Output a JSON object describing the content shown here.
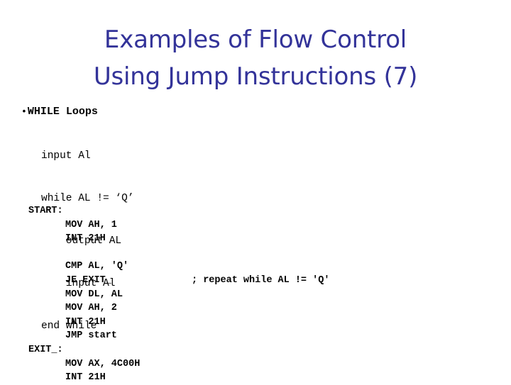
{
  "slide": {
    "background_color": "#ffffff",
    "title_color": "#333399",
    "text_color": "#000000",
    "title": {
      "lines": [
        "Examples of Flow Control",
        "Using Jump Instructions (7)"
      ]
    },
    "bullet": {
      "marker": "bullet-icon",
      "marker_glyph": "•",
      "label": "WHILE Loops"
    },
    "pseudocode": {
      "lines": [
        "input Al",
        "while AL != ‘Q’",
        "    output AL",
        "    input Al",
        "end while"
      ]
    },
    "assembly": {
      "rows": [
        {
          "label": "START:",
          "instruction": "",
          "comment": ""
        },
        {
          "label": "",
          "instruction": "MOV AH, 1",
          "comment": ""
        },
        {
          "label": "",
          "instruction": "INT 21H",
          "comment": ""
        },
        {
          "label": "",
          "instruction": "",
          "comment": ""
        },
        {
          "label": "",
          "instruction": "CMP AL, 'Q'",
          "comment": ""
        },
        {
          "label": "",
          "instruction": "JE EXIT_",
          "comment": "; repeat while AL != 'Q'"
        },
        {
          "label": "",
          "instruction": "MOV DL, AL",
          "comment": ""
        },
        {
          "label": "",
          "instruction": "MOV AH, 2",
          "comment": ""
        },
        {
          "label": "",
          "instruction": "INT 21H",
          "comment": ""
        },
        {
          "label": "",
          "instruction": "JMP start",
          "comment": ""
        },
        {
          "label": "EXIT_:",
          "instruction": "",
          "comment": ""
        },
        {
          "label": "",
          "instruction": "MOV AX, 4C00H",
          "comment": ""
        },
        {
          "label": "",
          "instruction": "INT 21H",
          "comment": ""
        }
      ]
    }
  }
}
